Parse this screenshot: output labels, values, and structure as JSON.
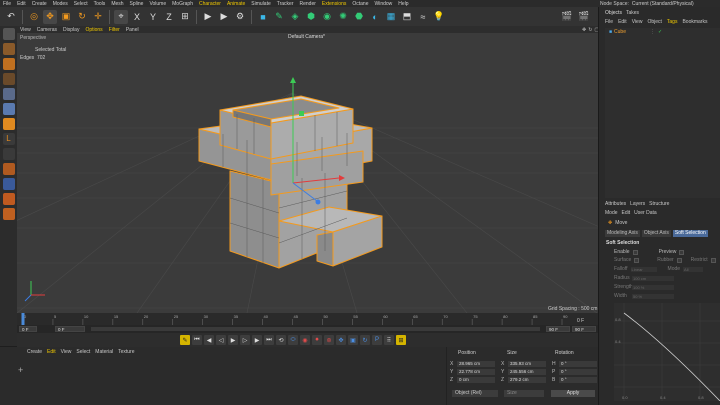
{
  "menubar": {
    "items": [
      "File",
      "Edit",
      "Create",
      "Modes",
      "Select",
      "Tools",
      "Mesh",
      "Spline",
      "Volume",
      "MoGraph",
      "Character",
      "Animate",
      "Simulate",
      "Tracker",
      "Render",
      "Extensions",
      "Octane",
      "Window",
      "Help"
    ],
    "highlight": [
      "Character",
      "Animate",
      "Extensions"
    ],
    "node_space_label": "Node Space:",
    "node_space_value": "Current (Standard/Physical)"
  },
  "viewport": {
    "menu": [
      "View",
      "Cameras",
      "Display",
      "Options",
      "Filter",
      "Panel"
    ],
    "highlight": [
      "Options",
      "Filter"
    ],
    "projection": "Perspective",
    "camera": "Default Camera",
    "camera_mark": "*",
    "stats": {
      "selected_total_label": "Selected Total",
      "edges_label": "Edges",
      "edges_value": "702"
    },
    "grid_spacing": "Grid Spacing : 500 cm"
  },
  "timeline": {
    "ticks": [
      "0",
      "5",
      "10",
      "15",
      "20",
      "25",
      "30",
      "35",
      "40",
      "45",
      "50",
      "55",
      "60",
      "65",
      "70",
      "75",
      "80",
      "85",
      "90"
    ],
    "end_label": "0 F",
    "start_field": "0 F",
    "current_field": "0 F",
    "max_field": "90 F",
    "max_field2": "90 F"
  },
  "materials": {
    "menu": [
      "Create",
      "Edit",
      "View",
      "Select",
      "Material",
      "Texture"
    ],
    "highlight": [
      "Edit"
    ],
    "add_symbol": "+"
  },
  "coordinates": {
    "headers": [
      "Position",
      "Size",
      "Rotation"
    ],
    "rows": [
      {
        "axis": "X",
        "pos": "28.965 cm",
        "size": "335.93 cm",
        "rot_axis": "H",
        "rot": "0 °"
      },
      {
        "axis": "Y",
        "pos": "22.778 cm",
        "size": "245.556 cm",
        "rot_axis": "P",
        "rot": "0 °"
      },
      {
        "axis": "Z",
        "pos": "0 cm",
        "size": "279.2 cm",
        "rot_axis": "B",
        "rot": "0 °"
      }
    ],
    "mode_dropdown": "Object (Rel)",
    "size_dropdown": "Size",
    "apply_label": "Apply"
  },
  "objects": {
    "tabs": [
      "Objects",
      "Takes"
    ],
    "menu": [
      "File",
      "Edit",
      "View",
      "Object",
      "Tags",
      "Bookmarks"
    ],
    "highlight": [
      "Tags"
    ],
    "items": [
      "Cube"
    ]
  },
  "attributes": {
    "tabs": [
      "Attributes",
      "Layers",
      "Structure"
    ],
    "menu": [
      "Mode",
      "Edit",
      "User Data"
    ],
    "tool": "Move",
    "subtabs": [
      "Modeling Axis",
      "Object Axis",
      "Soft Selection"
    ],
    "active_subtab": "Soft Selection",
    "section": "Soft Selection",
    "enable_label": "Enable",
    "preview_label": "Preview",
    "surface_label": "Surface",
    "rubber_label": "Rubber",
    "restrict_label": "Restrict",
    "falloff_label": "Falloff",
    "falloff_value": "Linear",
    "mode_label": "Mode",
    "mode_value": "All",
    "radius_label": "Radius",
    "radius_value": "100 cm",
    "strength_label": "Strength",
    "strength_value": "100 %",
    "width_label": "Width",
    "width_value": "50 %",
    "graph_y_ticks": [
      "0.8",
      "0.4"
    ],
    "graph_x_ticks": [
      "0.0",
      "0.4",
      "0.8"
    ]
  },
  "colors": {
    "accent_yellow": "#f0c800",
    "selection_orange": "#f39a1e",
    "axis_x": "#e23c3c",
    "axis_y": "#3ccc55",
    "axis_z": "#3c7de2",
    "viewport_bg": "#3b3b3b",
    "active_tab": "#4a6a9a"
  }
}
